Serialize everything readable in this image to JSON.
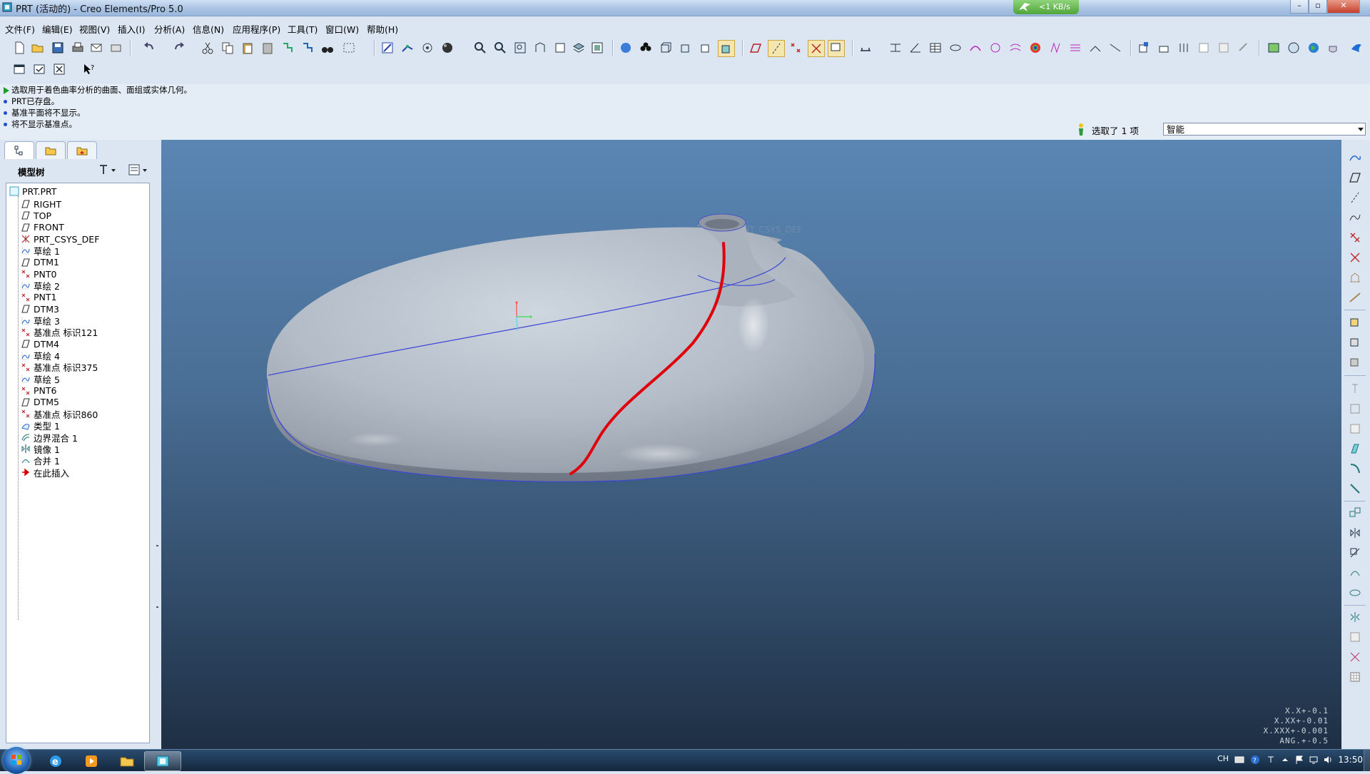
{
  "window": {
    "title": "PRT (活动的) - Creo Elements/Pro 5.0",
    "speed": "<1 KB/s",
    "controls": [
      "–",
      "▫",
      "✕"
    ]
  },
  "menu": [
    "文件(F)",
    "编辑(E)",
    "视图(V)",
    "插入(I)",
    "分析(A)",
    "信息(N)",
    "应用程序(P)",
    "工具(T)",
    "窗口(W)",
    "帮助(H)"
  ],
  "messages": [
    "选取用于着色曲率分析的曲面、面组或实体几何。",
    "PRT已存盘。",
    "基准平面将不显示。",
    "将不显示基准点。"
  ],
  "selection": {
    "status": "选取了 1 项",
    "filter": "智能"
  },
  "model_tree": {
    "header": "模型树",
    "root": "PRT.PRT",
    "items": [
      {
        "label": "RIGHT",
        "icon": "datum-plane-icon"
      },
      {
        "label": "TOP",
        "icon": "datum-plane-icon"
      },
      {
        "label": "FRONT",
        "icon": "datum-plane-icon"
      },
      {
        "label": "PRT_CSYS_DEF",
        "icon": "csys-icon"
      },
      {
        "label": "草绘 1",
        "icon": "sketch-icon"
      },
      {
        "label": "DTM1",
        "icon": "datum-plane-icon"
      },
      {
        "label": "PNT0",
        "icon": "datum-point-icon"
      },
      {
        "label": "草绘 2",
        "icon": "sketch-icon"
      },
      {
        "label": "PNT1",
        "icon": "datum-point-icon"
      },
      {
        "label": "DTM3",
        "icon": "datum-plane-icon"
      },
      {
        "label": "草绘 3",
        "icon": "sketch-icon"
      },
      {
        "label": "基准点 标识121",
        "icon": "datum-point-icon"
      },
      {
        "label": "DTM4",
        "icon": "datum-plane-icon"
      },
      {
        "label": "草绘 4",
        "icon": "sketch-icon"
      },
      {
        "label": "基准点 标识375",
        "icon": "datum-point-icon"
      },
      {
        "label": "草绘 5",
        "icon": "sketch-icon"
      },
      {
        "label": "PNT6",
        "icon": "datum-point-icon"
      },
      {
        "label": "DTM5",
        "icon": "datum-plane-icon"
      },
      {
        "label": "基准点 标识860",
        "icon": "datum-point-icon"
      },
      {
        "label": "类型 1",
        "icon": "style-icon"
      },
      {
        "label": "边界混合 1",
        "icon": "boundary-blend-icon"
      },
      {
        "label": "镜像 1",
        "icon": "mirror-icon"
      },
      {
        "label": "合并 1",
        "icon": "merge-icon"
      },
      {
        "label": "在此插入",
        "icon": "insert-here-arrow-icon"
      }
    ]
  },
  "viewport": {
    "faint_label": "PNT_CSYS_DEF",
    "tolerances": [
      "X.X+-0.1",
      "X.XX+-0.01",
      "X.XXX+-0.001",
      "ANG.+-0.5"
    ]
  },
  "taskbar": {
    "language": "CH",
    "clock": "13:50"
  },
  "colors": {
    "viewport_top": "#5a86b4",
    "viewport_bottom": "#1e2f44",
    "highlight_curve": "#e0000b",
    "edge_lines": "#3a45d8",
    "ui_background": "#dbe6f2"
  }
}
